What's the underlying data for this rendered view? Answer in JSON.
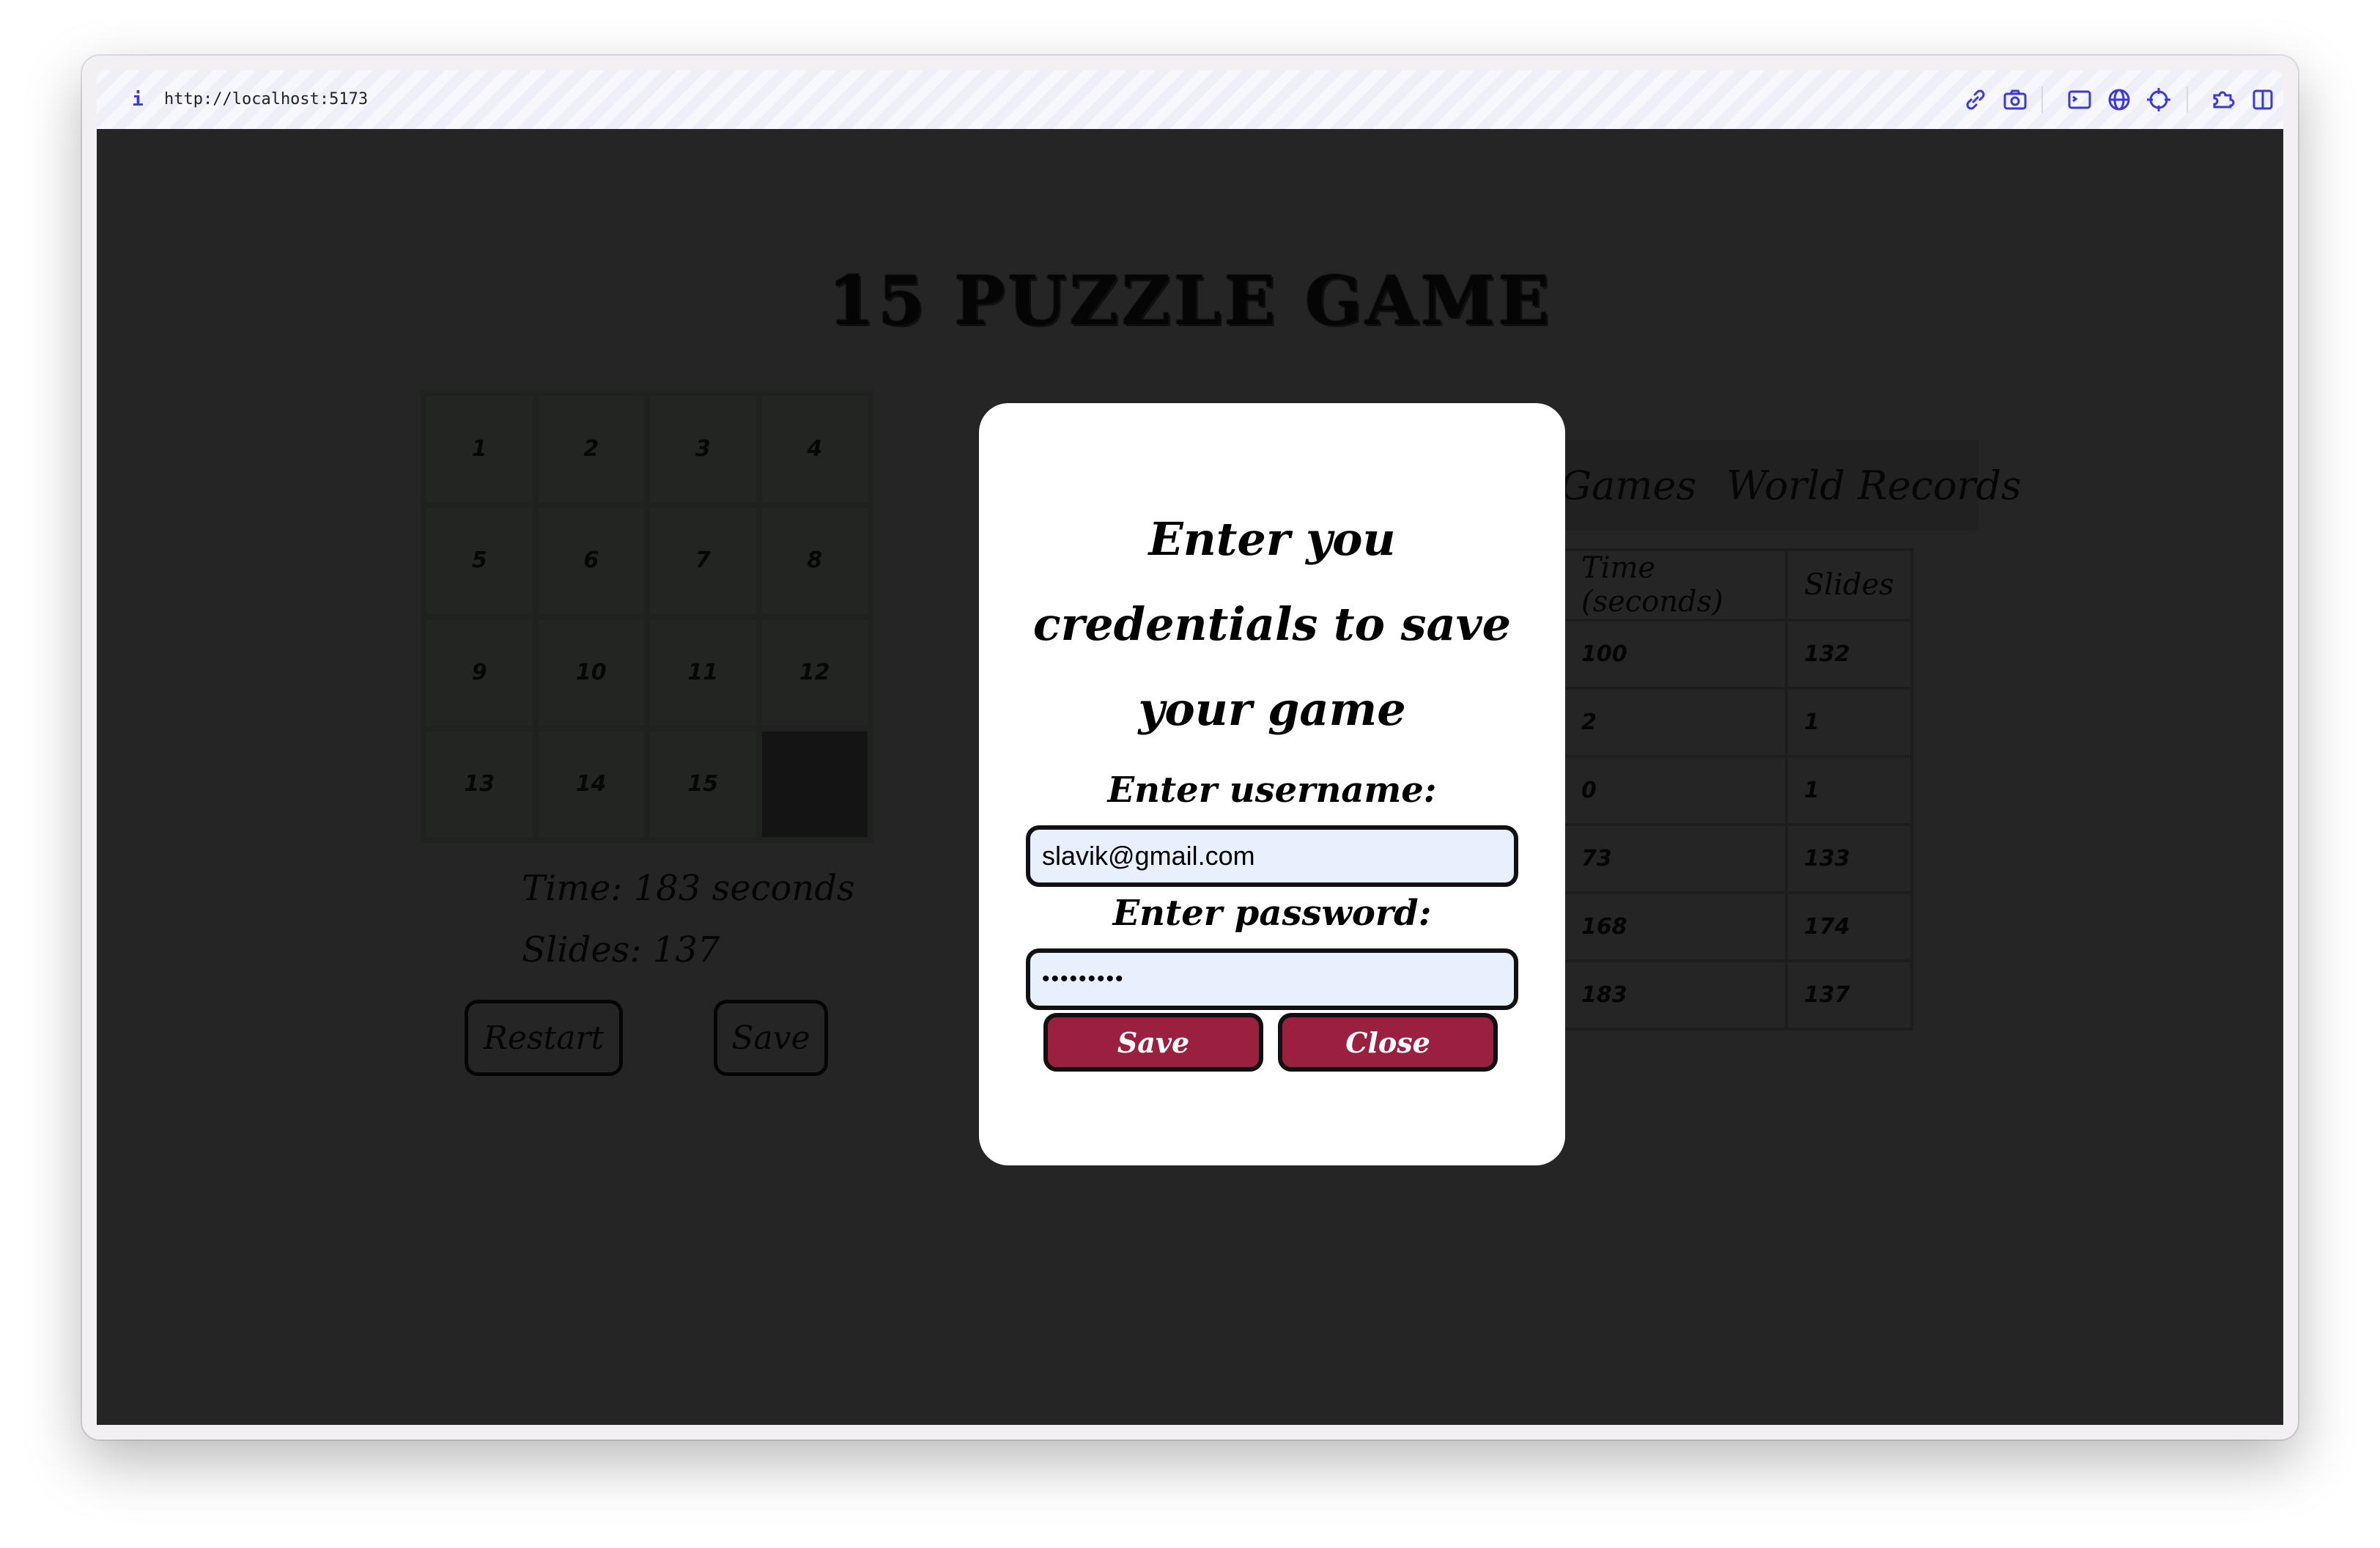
{
  "browser": {
    "info_glyph": "i",
    "url": "http://localhost:5173",
    "icons": [
      "link-icon",
      "camera-icon",
      "terminal-icon",
      "globe-icon",
      "crosshair-icon",
      "extension-icon",
      "sidebar-icon"
    ],
    "accent_color": "#3a3ad6"
  },
  "game": {
    "title": "15 PUZZLE GAME",
    "tiles": [
      "1",
      "2",
      "3",
      "4",
      "5",
      "6",
      "7",
      "8",
      "9",
      "10",
      "11",
      "12",
      "13",
      "14",
      "15",
      ""
    ],
    "time_label": "Time: 183 seconds",
    "slides_label": "Slides: 137",
    "restart_label": "Restart",
    "save_label": "Save"
  },
  "scores": {
    "tabs": [
      {
        "label": "My Games",
        "active": true
      },
      {
        "label": "World Records",
        "active": false
      }
    ],
    "headers": [
      "Time (seconds)",
      "Slides"
    ],
    "rows": [
      [
        "100",
        "132"
      ],
      [
        "2",
        "1"
      ],
      [
        "0",
        "1"
      ],
      [
        "73",
        "133"
      ],
      [
        "168",
        "174"
      ],
      [
        "183",
        "137"
      ]
    ]
  },
  "modal": {
    "title": "Enter you credentials to save your game",
    "username_label": "Enter username:",
    "username_value": "slavik@gmail.com",
    "password_label": "Enter password:",
    "password_value": "•••••••••",
    "save_label": "Save",
    "close_label": "Close",
    "button_color": "#9b1f3e"
  }
}
